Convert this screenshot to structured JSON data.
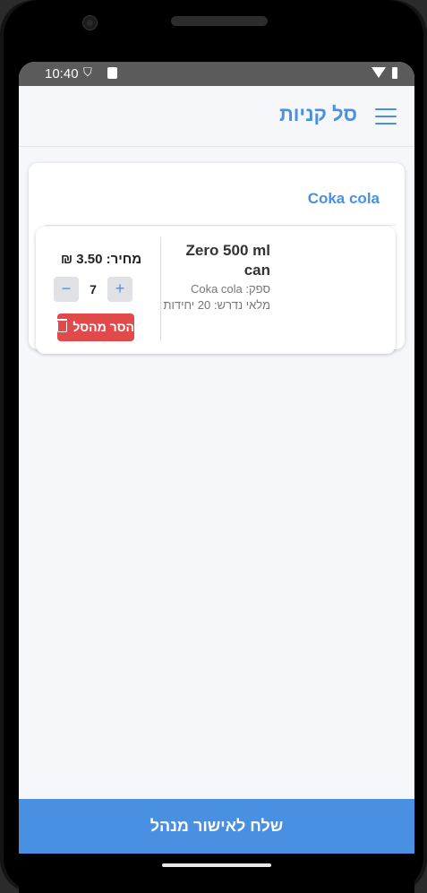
{
  "status_bar": {
    "time": "10:40"
  },
  "app_bar": {
    "title": "סל קניות",
    "menu_icon": "hamburger-menu-icon"
  },
  "cart": {
    "supplier": "Coka cola",
    "items": [
      {
        "name": "Zero 500 ml can",
        "supplier_line": "ספק: Coka cola",
        "stock_line": "מלאי נדרש: 20 יחידות",
        "price_line": "מחיר: 3.50 ₪",
        "quantity": "7",
        "minus_label": "−",
        "plus_label": "+",
        "remove_label": "הסר מהסל"
      }
    ]
  },
  "footer": {
    "submit_label": "שלח לאישור מנהל"
  },
  "colors": {
    "accent": "#4a90e2",
    "danger": "#e14a4a",
    "background": "#f5f7fa"
  }
}
